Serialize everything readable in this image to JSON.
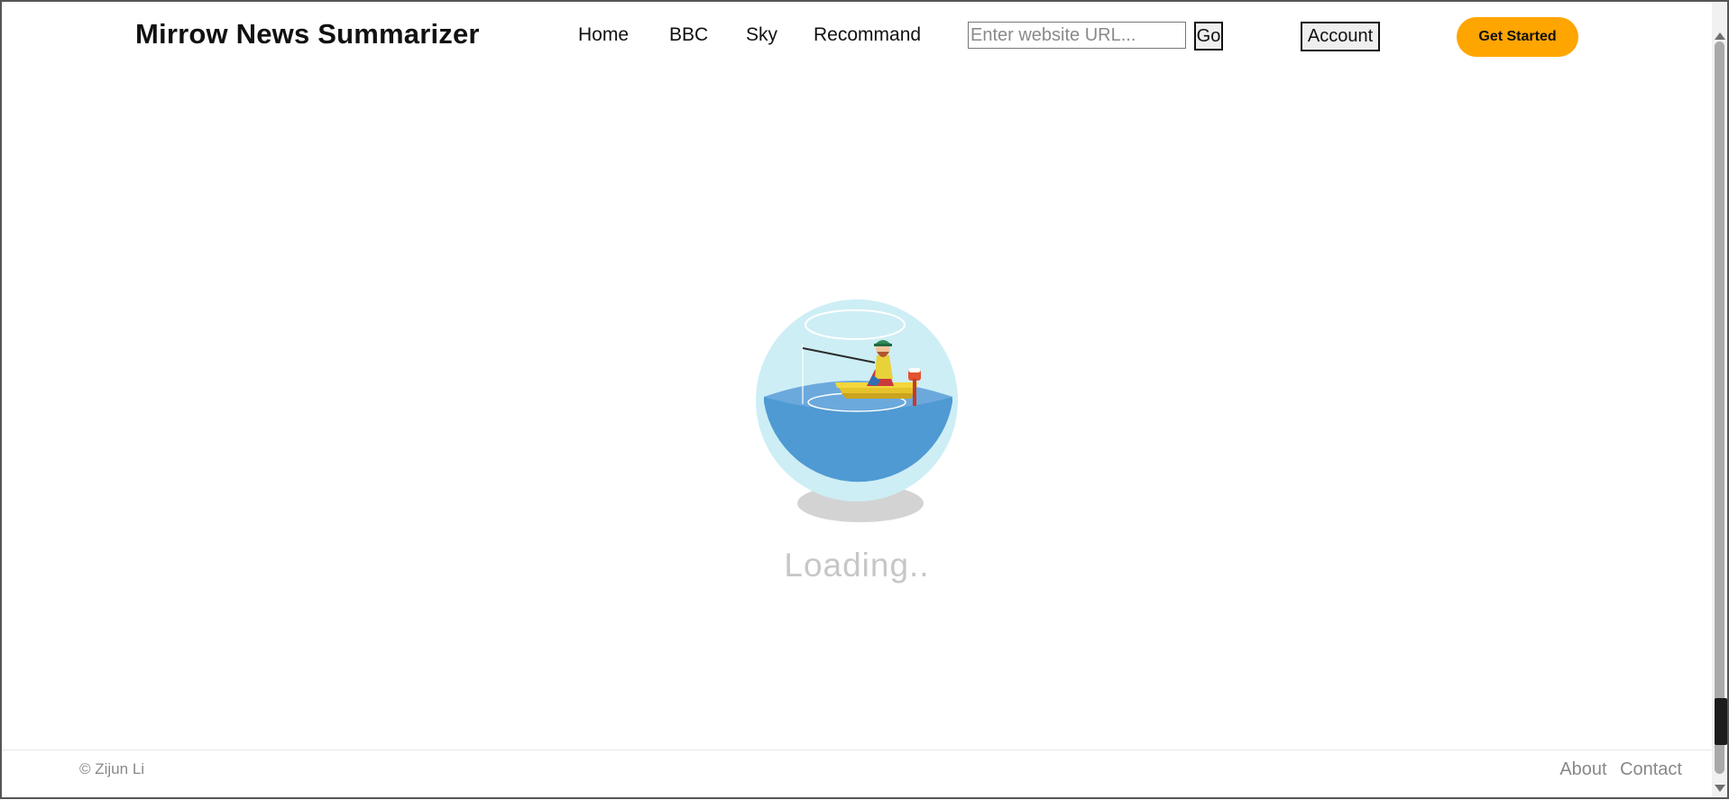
{
  "header": {
    "brand": "Mirrow News Summarizer",
    "nav": [
      "Home",
      "BBC",
      "Sky",
      "Recommand"
    ],
    "url_placeholder": "Enter website URL...",
    "go_label": "Go",
    "account_label": "Account",
    "cta_label": "Get Started"
  },
  "main": {
    "loading_text": "Loading..",
    "illustration": "fisherman-in-boat-globe-icon"
  },
  "footer": {
    "copyright": "© Zijun Li",
    "links": [
      "About",
      "Contact"
    ]
  },
  "colors": {
    "accent": "#ffa500",
    "water": "#4d9ad1",
    "globe": "#cdeef5",
    "loading_text": "#c7c7c7"
  }
}
